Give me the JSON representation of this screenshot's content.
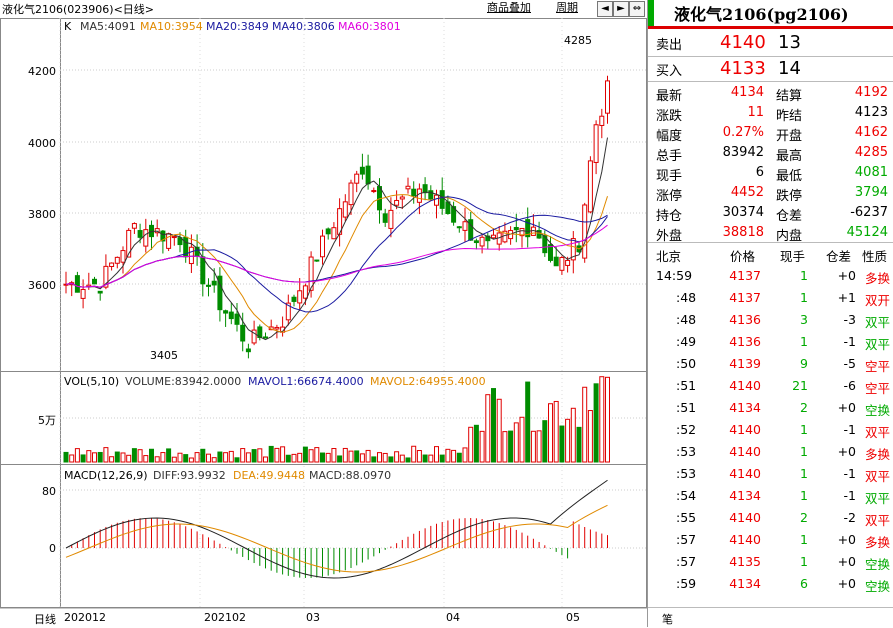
{
  "window": {
    "title": "液化气2106(023906)<日线>",
    "buttons": [
      "商品叠加",
      "周期"
    ],
    "nav_icons": [
      "◄",
      "►",
      "⇔"
    ]
  },
  "ma_legend": {
    "k_label": "K",
    "ma5": "MA5:4091",
    "ma10": "MA10:3954",
    "ma20": "MA20:3849",
    "ma40": "MA40:3806",
    "ma60": "MA60:3801"
  },
  "vol_legend": {
    "label": "VOL(5,10)",
    "volume": "VOLUME:83942.0000",
    "mavol1": "MAVOL1:66674.4000",
    "mavol2": "MAVOL2:64955.4000",
    "axis_label": "5万"
  },
  "macd_legend": {
    "label": "MACD(12,26,9)",
    "diff": "DIFF:93.9932",
    "dea": "DEA:49.9448",
    "macd": "MACD:88.0970",
    "axis": [
      "80",
      "0"
    ]
  },
  "price_axis": [
    "4200",
    "4000",
    "3800",
    "3600"
  ],
  "annotations": {
    "high": "4285",
    "low": "3405"
  },
  "x_axis": {
    "period": "日线",
    "labels": [
      "202012",
      "202102",
      "03",
      "04",
      "05"
    ]
  },
  "colors": {
    "up": "#e00000",
    "down": "#008c00",
    "ma5": "#333333",
    "ma10": "#e08a00",
    "ma20": "#1a1aa0",
    "ma40": "#1a1aa0",
    "ma60": "#e000e0"
  },
  "right_panel": {
    "title": "液化气2106(pg2106)",
    "sell": {
      "label": "卖出",
      "price": "4140",
      "vol": "13"
    },
    "buy": {
      "label": "买入",
      "price": "4133",
      "vol": "14"
    },
    "stats": [
      {
        "l1": "最新",
        "v1": "4134",
        "c1": "red",
        "l2": "结算",
        "v2": "4192",
        "c2": "red"
      },
      {
        "l1": "涨跌",
        "v1": "11",
        "c1": "red",
        "l2": "昨结",
        "v2": "4123",
        "c2": "black"
      },
      {
        "l1": "幅度",
        "v1": "0.27%",
        "c1": "red",
        "l2": "开盘",
        "v2": "4162",
        "c2": "red"
      },
      {
        "l1": "总手",
        "v1": "83942",
        "c1": "black",
        "l2": "最高",
        "v2": "4285",
        "c2": "red"
      },
      {
        "l1": "现手",
        "v1": "6",
        "c1": "black",
        "l2": "最低",
        "v2": "4081",
        "c2": "grn"
      },
      {
        "l1": "涨停",
        "v1": "4452",
        "c1": "red",
        "l2": "跌停",
        "v2": "3794",
        "c2": "grn"
      },
      {
        "l1": "持仓",
        "v1": "30374",
        "c1": "black",
        "l2": "仓差",
        "v2": "-6237",
        "c2": "black"
      },
      {
        "l1": "外盘",
        "v1": "38818",
        "c1": "red",
        "l2": "内盘",
        "v2": "45124",
        "c2": "grn"
      }
    ],
    "tick_headers": [
      "北京",
      "价格",
      "现手",
      "仓差",
      "性质"
    ],
    "ticks": [
      {
        "t": "14:59",
        "p": "4137",
        "v": "1",
        "d": "+0",
        "n": "多换",
        "nc": "red"
      },
      {
        "t": ":48",
        "p": "4137",
        "v": "1",
        "d": "+1",
        "n": "双开",
        "nc": "red"
      },
      {
        "t": ":48",
        "p": "4136",
        "v": "3",
        "d": "-3",
        "n": "双平",
        "nc": "grn"
      },
      {
        "t": ":49",
        "p": "4136",
        "v": "1",
        "d": "-1",
        "n": "双平",
        "nc": "grn"
      },
      {
        "t": ":50",
        "p": "4139",
        "v": "9",
        "d": "-5",
        "n": "空平",
        "nc": "red"
      },
      {
        "t": ":51",
        "p": "4140",
        "v": "21",
        "d": "-6",
        "n": "空平",
        "nc": "red"
      },
      {
        "t": ":51",
        "p": "4134",
        "v": "2",
        "d": "+0",
        "n": "空换",
        "nc": "grn"
      },
      {
        "t": ":52",
        "p": "4140",
        "v": "1",
        "d": "-1",
        "n": "双平",
        "nc": "red"
      },
      {
        "t": ":53",
        "p": "4140",
        "v": "1",
        "d": "+0",
        "n": "多换",
        "nc": "red"
      },
      {
        "t": ":53",
        "p": "4140",
        "v": "1",
        "d": "-1",
        "n": "双平",
        "nc": "red"
      },
      {
        "t": ":54",
        "p": "4134",
        "v": "1",
        "d": "-1",
        "n": "双平",
        "nc": "grn"
      },
      {
        "t": ":55",
        "p": "4140",
        "v": "2",
        "d": "-2",
        "n": "双平",
        "nc": "red"
      },
      {
        "t": ":57",
        "p": "4140",
        "v": "1",
        "d": "+0",
        "n": "多换",
        "nc": "red"
      },
      {
        "t": ":57",
        "p": "4135",
        "v": "1",
        "d": "+0",
        "n": "空换",
        "nc": "grn"
      },
      {
        "t": ":59",
        "p": "4134",
        "v": "6",
        "d": "+0",
        "n": "空换",
        "nc": "grn"
      }
    ],
    "footer_tab": "笔"
  }
}
